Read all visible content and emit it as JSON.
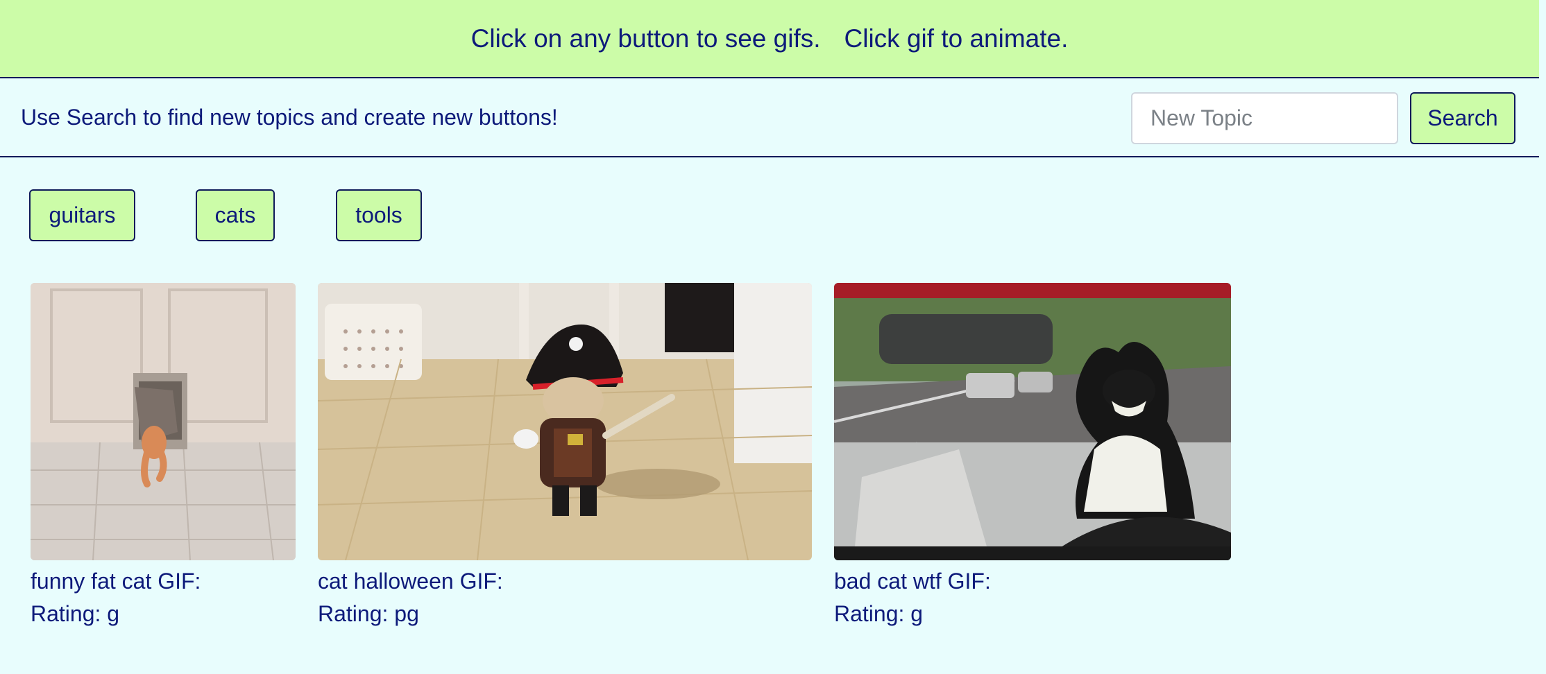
{
  "banner": {
    "instruction_buttons": "Click on any button to see gifs.",
    "instruction_animate": "Click gif to animate."
  },
  "search": {
    "hint": "Use Search to find new topics and create new buttons!",
    "placeholder": "New Topic",
    "value": "",
    "button_label": "Search"
  },
  "topics": [
    {
      "label": "guitars"
    },
    {
      "label": "cats"
    },
    {
      "label": "tools"
    }
  ],
  "gifs": [
    {
      "title": "funny fat cat GIF:",
      "rating": "Rating: g",
      "image": "cat squeezing through pet door"
    },
    {
      "title": "cat halloween GIF:",
      "rating": "Rating: pg",
      "image": "cat in pirate costume"
    },
    {
      "title": "bad cat wtf GIF:",
      "rating": "Rating: g",
      "image": "cat driving a car"
    }
  ],
  "colors": {
    "page_background": "#e8fdfd",
    "accent_green": "#ccfca8",
    "text_navy": "#0d1a7a"
  }
}
